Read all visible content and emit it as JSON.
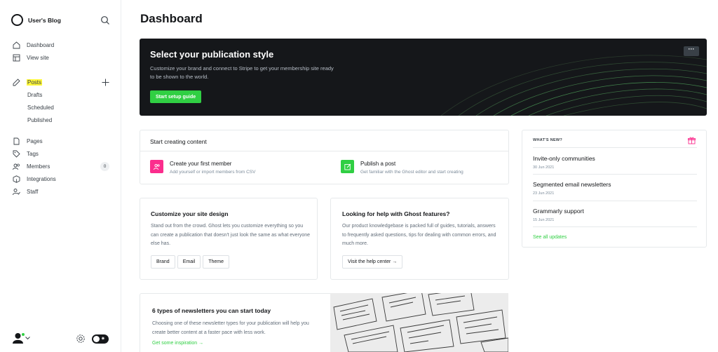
{
  "sidebar": {
    "site_name": "User's Blog",
    "primary": [
      {
        "label": "Dashboard"
      },
      {
        "label": "View site"
      }
    ],
    "posts": {
      "label": "Posts",
      "subitems": [
        {
          "label": "Drafts"
        },
        {
          "label": "Scheduled"
        },
        {
          "label": "Published"
        }
      ]
    },
    "secondary": [
      {
        "label": "Pages"
      },
      {
        "label": "Tags"
      },
      {
        "label": "Members",
        "count": "0"
      },
      {
        "label": "Integrations"
      },
      {
        "label": "Staff"
      }
    ]
  },
  "header": {
    "title": "Dashboard"
  },
  "hero": {
    "title": "Select your publication style",
    "description": "Customize your brand and connect to Stripe to get your membership site ready to be shown to the world.",
    "button": "Start setup guide",
    "more": "···"
  },
  "start_creating": {
    "title": "Start creating content",
    "tasks": [
      {
        "title": "Create your first member",
        "subtitle": "Add yourself or import members from CSV"
      },
      {
        "title": "Publish a post",
        "subtitle": "Get familiar with the Ghost editor and start creating"
      }
    ]
  },
  "customize": {
    "title": "Customize your site design",
    "body": "Stand out from the crowd. Ghost lets you customize everything so you can create a publication that doesn't just look the same as what everyone else has.",
    "buttons": [
      "Brand",
      "Email",
      "Theme"
    ]
  },
  "help": {
    "title": "Looking for help with Ghost features?",
    "body": "Our product knowledgebase is packed full of guides, tutorials, answers to frequently asked questions, tips for dealing with common errors, and much more.",
    "button": "Visit the help center →"
  },
  "whats_new": {
    "label": "WHAT'S NEW?",
    "items": [
      {
        "title": "Invite-only communities",
        "date": "30 Jun 2021"
      },
      {
        "title": "Segmented email newsletters",
        "date": "23 Jun 2021"
      },
      {
        "title": "Grammarly support",
        "date": "15 Jun 2021"
      }
    ],
    "link": "See all updates"
  },
  "newsletter": {
    "title": "6 types of newsletters you can start today",
    "body": "Choosing one of these newsletter types for your publication will help you create better content at a faster pace with less work.",
    "link": "Get some inspiration →"
  },
  "colors": {
    "accent": "#30cf43",
    "highlight": "#fff83a",
    "dark": "#15171a",
    "member_icon": "#fb2d8d"
  },
  "icons": [
    "search-icon",
    "home-icon",
    "view-site-icon",
    "pencil-icon",
    "plus-icon",
    "page-icon",
    "tag-icon",
    "members-icon",
    "integrations-icon",
    "staff-icon",
    "gear-icon",
    "gift-icon"
  ]
}
